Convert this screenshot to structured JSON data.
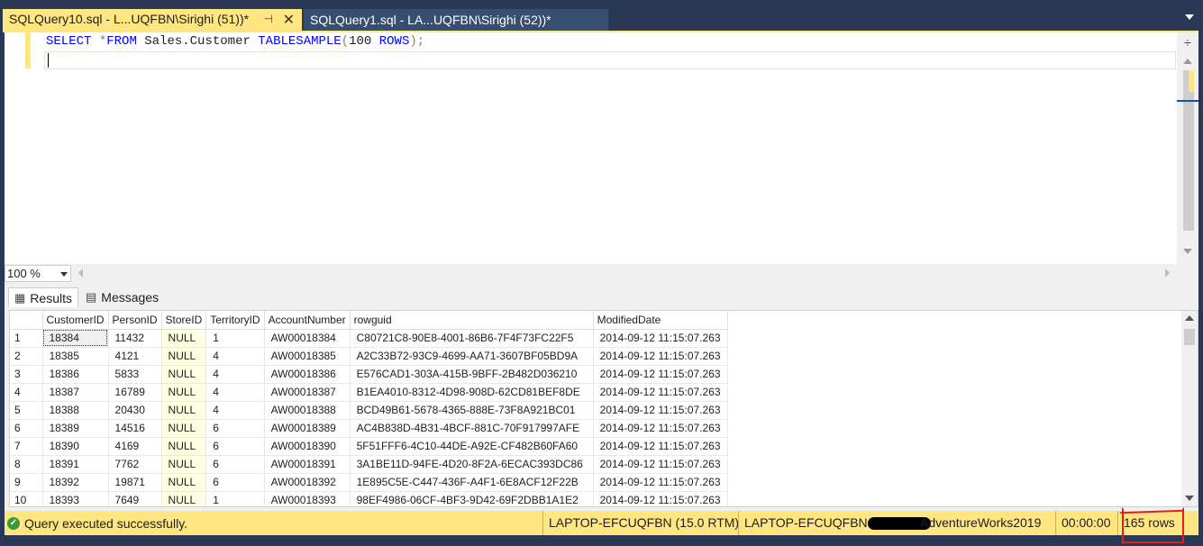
{
  "tabs": [
    {
      "label": "SQLQuery10.sql - L...UQFBN\\Sirighi (51))*",
      "active": true
    },
    {
      "label": "SQLQuery1.sql - LA...UQFBN\\Sirighi (52))*",
      "active": false
    }
  ],
  "editor": {
    "line1": {
      "kw_select": "SELECT",
      "star": "*",
      "kw_from": "FROM",
      "table": "Sales.Customer",
      "kw_tablesample": "TABLESAMPLE",
      "open_paren": "(",
      "num": "100",
      "kw_rows": "ROWS",
      "close": ");"
    }
  },
  "zoom": {
    "value": "100 %"
  },
  "result_tabs": {
    "results": "Results",
    "messages": "Messages"
  },
  "grid": {
    "columns": [
      "CustomerID",
      "PersonID",
      "StoreID",
      "TerritoryID",
      "AccountNumber",
      "rowguid",
      "ModifiedDate"
    ],
    "rows": [
      [
        "1",
        "18384",
        "11432",
        "NULL",
        "1",
        "AW00018384",
        "C80721C8-90E8-4001-86B6-7F4F73FC22F5",
        "2014-09-12 11:15:07.263"
      ],
      [
        "2",
        "18385",
        "4121",
        "NULL",
        "4",
        "AW00018385",
        "A2C33B72-93C9-4699-AA71-3607BF05BD9A",
        "2014-09-12 11:15:07.263"
      ],
      [
        "3",
        "18386",
        "5833",
        "NULL",
        "4",
        "AW00018386",
        "E576CAD1-303A-415B-9BFF-2B482D036210",
        "2014-09-12 11:15:07.263"
      ],
      [
        "4",
        "18387",
        "16789",
        "NULL",
        "4",
        "AW00018387",
        "B1EA4010-8312-4D98-908D-62CD81BEF8DE",
        "2014-09-12 11:15:07.263"
      ],
      [
        "5",
        "18388",
        "20430",
        "NULL",
        "4",
        "AW00018388",
        "BCD49B61-5678-4365-888E-73F8A921BC01",
        "2014-09-12 11:15:07.263"
      ],
      [
        "6",
        "18389",
        "14516",
        "NULL",
        "6",
        "AW00018389",
        "AC4B838D-4B31-4BCF-881C-70F917997AFE",
        "2014-09-12 11:15:07.263"
      ],
      [
        "7",
        "18390",
        "4169",
        "NULL",
        "6",
        "AW00018390",
        "5F51FFF6-4C10-44DE-A92E-CF482B60FA60",
        "2014-09-12 11:15:07.263"
      ],
      [
        "8",
        "18391",
        "7762",
        "NULL",
        "6",
        "AW00018391",
        "3A1BE11D-94FE-4D20-8F2A-6ECAC393DC86",
        "2014-09-12 11:15:07.263"
      ],
      [
        "9",
        "18392",
        "19871",
        "NULL",
        "6",
        "AW00018392",
        "1E895C5E-C447-436F-A4F1-6E8ACF12F22B",
        "2014-09-12 11:15:07.263"
      ],
      [
        "10",
        "18393",
        "7649",
        "NULL",
        "1",
        "AW00018393",
        "98EF4986-06CF-4BF3-9D42-69F2DBB1A1E2",
        "2014-09-12 11:15:07.263"
      ]
    ]
  },
  "status": {
    "message": "Query executed successfully.",
    "server": "LAPTOP-EFCUQFBN (15.0 RTM)",
    "login_prefix": "LAPTOP-EFCUQFBN",
    "database": "AdventureWorks2019",
    "elapsed": "00:00:00",
    "rows": "165 rows"
  },
  "colors": {
    "accent_yellow": "#ffe680",
    "chrome_blue": "#293955",
    "keyword_blue": "#0000ff",
    "null_cell": "#ffffe1",
    "annotation_red": "#e02020"
  }
}
